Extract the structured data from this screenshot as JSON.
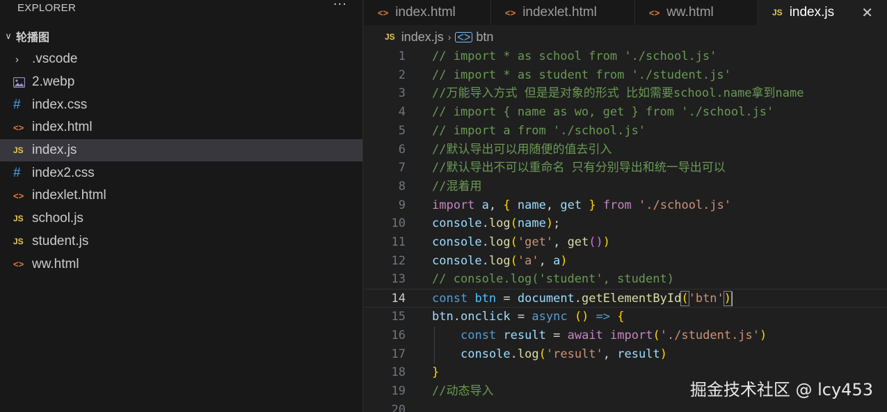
{
  "explorer": {
    "title": "EXPLORER",
    "more": "···",
    "folder_chevron": "∨",
    "folder": "轮播图",
    "items": [
      {
        "icon": "chevron-right-icon",
        "glyph": "›",
        "label": ".vscode"
      },
      {
        "icon": "image-icon",
        "glyph": "",
        "label": "2.webp"
      },
      {
        "icon": "css-icon",
        "glyph": "#",
        "label": "index.css"
      },
      {
        "icon": "html-icon",
        "glyph": "<>",
        "label": "index.html"
      },
      {
        "icon": "js-icon",
        "glyph": "JS",
        "label": "index.js"
      },
      {
        "icon": "css-icon",
        "glyph": "#",
        "label": "index2.css"
      },
      {
        "icon": "html-icon",
        "glyph": "<>",
        "label": "indexlet.html"
      },
      {
        "icon": "js-icon",
        "glyph": "JS",
        "label": "school.js"
      },
      {
        "icon": "js-icon",
        "glyph": "JS",
        "label": "student.js"
      },
      {
        "icon": "html-icon",
        "glyph": "<>",
        "label": "ww.html"
      }
    ],
    "selected_index": 4
  },
  "tabs": [
    {
      "label": "index.html",
      "glyph": "<>",
      "icon": "html-icon"
    },
    {
      "label": "indexlet.html",
      "glyph": "<>",
      "icon": "html-icon"
    },
    {
      "label": "ww.html",
      "glyph": "<>",
      "icon": "html-icon"
    },
    {
      "label": "index.js",
      "glyph": "JS",
      "icon": "js-icon",
      "active": true,
      "close": "✕"
    }
  ],
  "breadcrumb": {
    "file_glyph": "JS",
    "file": "index.js",
    "sep": "›",
    "symbol_glyph": "ᐸᐳ",
    "symbol": "btn"
  },
  "editor": {
    "current_line": 14,
    "lines": [
      {
        "n": "1",
        "code": "// import * as school from './school.js'"
      },
      {
        "n": "2",
        "code": "// import * as student from './student.js'"
      },
      {
        "n": "3",
        "code": "//万能导入方式 但是是对象的形式 比如需要school.name拿到name"
      },
      {
        "n": "4",
        "code": "// import { name as wo, get } from './school.js'"
      },
      {
        "n": "5",
        "code": "// import a from './school.js'"
      },
      {
        "n": "6",
        "code": "//默认导出可以用随便的值去引入"
      },
      {
        "n": "7",
        "code": "//默认导出不可以重命名 只有分别导出和统一导出可以"
      },
      {
        "n": "8",
        "code": "//混着用"
      },
      {
        "n": "9",
        "code": "import a, { name, get } from './school.js'"
      },
      {
        "n": "10",
        "code": "console.log(name);"
      },
      {
        "n": "11",
        "code": "console.log('get', get())"
      },
      {
        "n": "12",
        "code": "console.log('a', a)"
      },
      {
        "n": "13",
        "code": "// console.log('student', student)"
      },
      {
        "n": "14",
        "code": "const btn = document.getElementById('btn')"
      },
      {
        "n": "15",
        "code": "btn.onclick = async () => {"
      },
      {
        "n": "16",
        "code": "    const result = await import('./student.js')"
      },
      {
        "n": "17",
        "code": "    console.log('result', result)"
      },
      {
        "n": "18",
        "code": "}"
      },
      {
        "n": "19",
        "code": "//动态导入"
      },
      {
        "n": "20",
        "code": ""
      }
    ]
  },
  "watermark": "掘金技术社区 @ lcy453",
  "colors": {
    "background": "#1f1f1f",
    "sidebar": "#181818",
    "selected_row": "#37373d",
    "comment": "#6a9955",
    "keyword": "#c586c0",
    "string": "#ce9178",
    "function": "#dcdcaa",
    "variable": "#9cdcfe",
    "js_icon": "#e6c84f",
    "html_icon": "#e37933",
    "css_icon": "#42a5f5"
  }
}
